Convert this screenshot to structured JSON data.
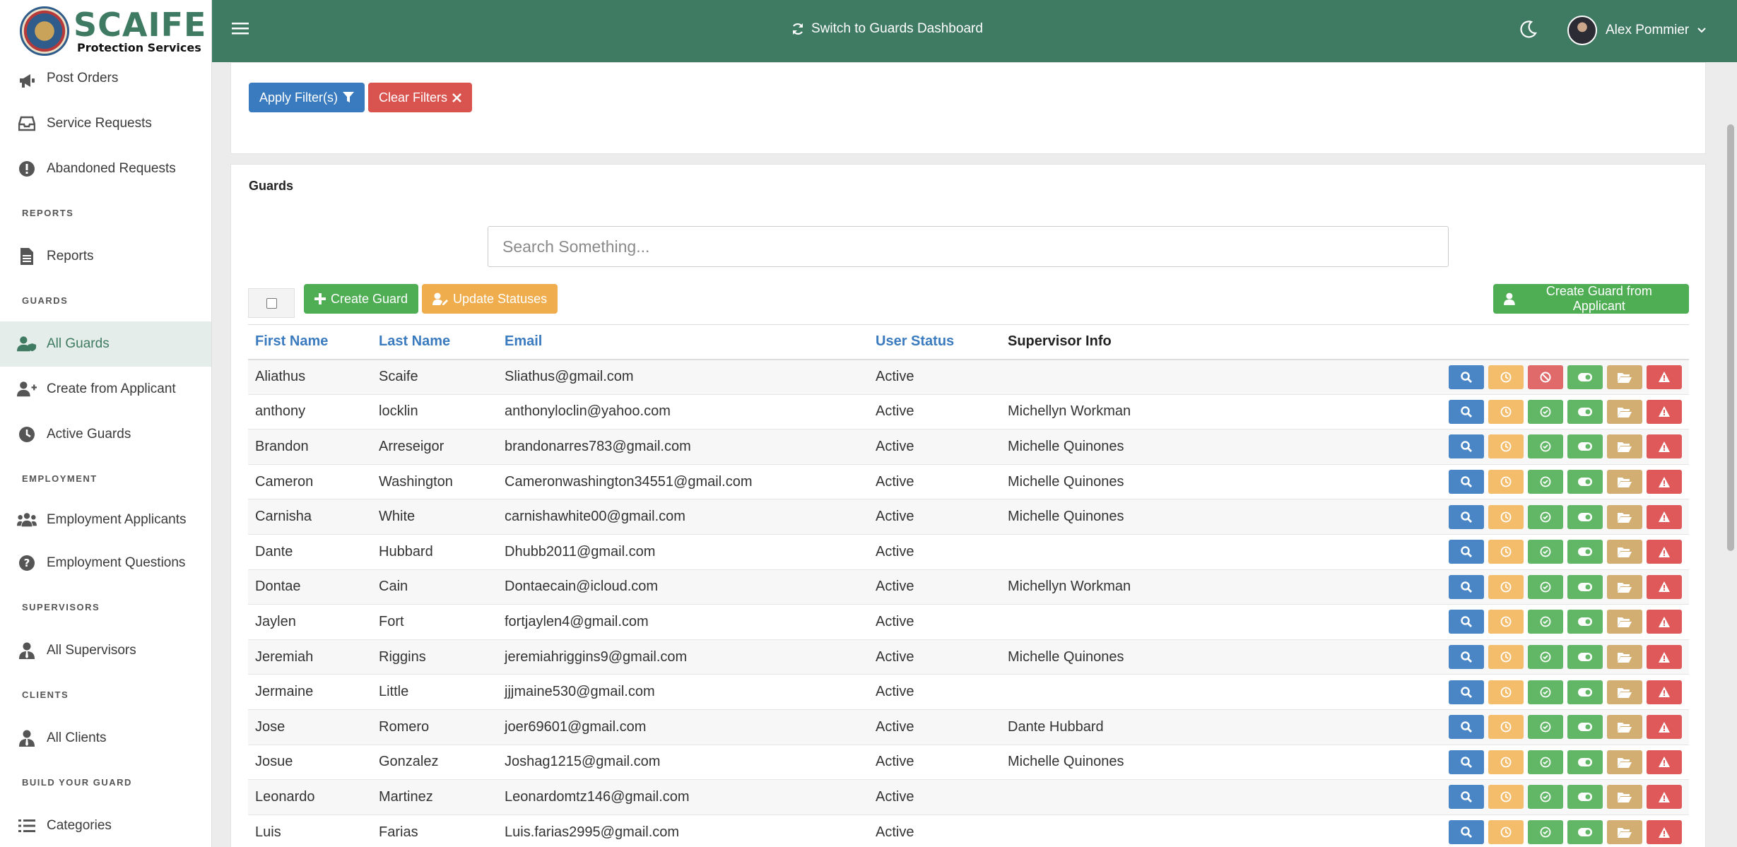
{
  "brand": {
    "name": "SCAIFE",
    "tagline": "Protection Services"
  },
  "sidebar": {
    "items": [
      {
        "key": "post-orders",
        "label": "Post Orders",
        "icon": "megaphone-icon"
      },
      {
        "key": "service-requests",
        "label": "Service Requests",
        "icon": "inbox-icon"
      },
      {
        "key": "abandoned-requests",
        "label": "Abandoned Requests",
        "icon": "exclamation-circle-icon"
      }
    ],
    "sections": [
      {
        "heading": "REPORTS",
        "items": [
          {
            "label": "Reports",
            "icon": "document-icon"
          }
        ]
      },
      {
        "heading": "GUARDS",
        "items": [
          {
            "label": "All Guards",
            "icon": "user-shield-icon",
            "active": true
          },
          {
            "label": "Create from Applicant",
            "icon": "user-plus-icon"
          },
          {
            "label": "Active Guards",
            "icon": "clock-icon"
          }
        ]
      },
      {
        "heading": "EMPLOYMENT",
        "items": [
          {
            "label": "Employment Applicants",
            "icon": "users-icon"
          },
          {
            "label": "Employment Questions",
            "icon": "question-circle-icon"
          }
        ]
      },
      {
        "heading": "SUPERVISORS",
        "items": [
          {
            "label": "All Supervisors",
            "icon": "user-tie-icon"
          }
        ]
      },
      {
        "heading": "CLIENTS",
        "items": [
          {
            "label": "All Clients",
            "icon": "user-tie-icon"
          }
        ]
      },
      {
        "heading": "BUILD YOUR GUARD",
        "items": [
          {
            "label": "Categories",
            "icon": "list-icon"
          }
        ]
      }
    ]
  },
  "topbar": {
    "switch_label": "Switch to Guards Dashboard",
    "user_name": "Alex Pommier"
  },
  "filters": {
    "apply_label": "Apply Filter(s)",
    "clear_label": "Clear Filters"
  },
  "guards": {
    "title": "Guards",
    "search_placeholder": "Search Something...",
    "create_label": "Create Guard",
    "update_label": "Update Statuses",
    "create_from_applicant_label": "Create Guard from Applicant",
    "columns": [
      "First Name",
      "Last Name",
      "Email",
      "User Status",
      "Supervisor Info"
    ],
    "rows": [
      {
        "first": "Aliathus",
        "last": "Scaife",
        "email": "Sliathus@gmail.com",
        "status": "Active",
        "supervisor": "",
        "disabled": true
      },
      {
        "first": "anthony",
        "last": "locklin",
        "email": "anthonyloclin@yahoo.com",
        "status": "Active",
        "supervisor": "Michellyn Workman"
      },
      {
        "first": "Brandon",
        "last": "Arreseigor",
        "email": "brandonarres783@gmail.com",
        "status": "Active",
        "supervisor": "Michelle Quinones"
      },
      {
        "first": "Cameron",
        "last": "Washington",
        "email": "Cameronwashington34551@gmail.com",
        "status": "Active",
        "supervisor": "Michelle Quinones"
      },
      {
        "first": "Carnisha",
        "last": "White",
        "email": "carnishawhite00@gmail.com",
        "status": "Active",
        "supervisor": "Michelle Quinones"
      },
      {
        "first": "Dante",
        "last": "Hubbard",
        "email": "Dhubb2011@gmail.com",
        "status": "Active",
        "supervisor": ""
      },
      {
        "first": "Dontae",
        "last": "Cain",
        "email": "Dontaecain@icloud.com",
        "status": "Active",
        "supervisor": "Michellyn Workman"
      },
      {
        "first": "Jaylen",
        "last": "Fort",
        "email": "fortjaylen4@gmail.com",
        "status": "Active",
        "supervisor": ""
      },
      {
        "first": "Jeremiah",
        "last": "Riggins",
        "email": "jeremiahriggins9@gmail.com",
        "status": "Active",
        "supervisor": "Michelle Quinones"
      },
      {
        "first": "Jermaine",
        "last": "Little",
        "email": "jjjmaine530@gmail.com",
        "status": "Active",
        "supervisor": ""
      },
      {
        "first": "Jose",
        "last": "Romero",
        "email": "joer69601@gmail.com",
        "status": "Active",
        "supervisor": "Dante Hubbard"
      },
      {
        "first": "Josue",
        "last": "Gonzalez",
        "email": "Joshag1215@gmail.com",
        "status": "Active",
        "supervisor": "Michelle Quinones"
      },
      {
        "first": "Leonardo",
        "last": "Martinez",
        "email": "Leonardomtz146@gmail.com",
        "status": "Active",
        "supervisor": ""
      },
      {
        "first": "Luis",
        "last": "Farias",
        "email": "Luis.farias2995@gmail.com",
        "status": "Active",
        "supervisor": ""
      }
    ]
  }
}
